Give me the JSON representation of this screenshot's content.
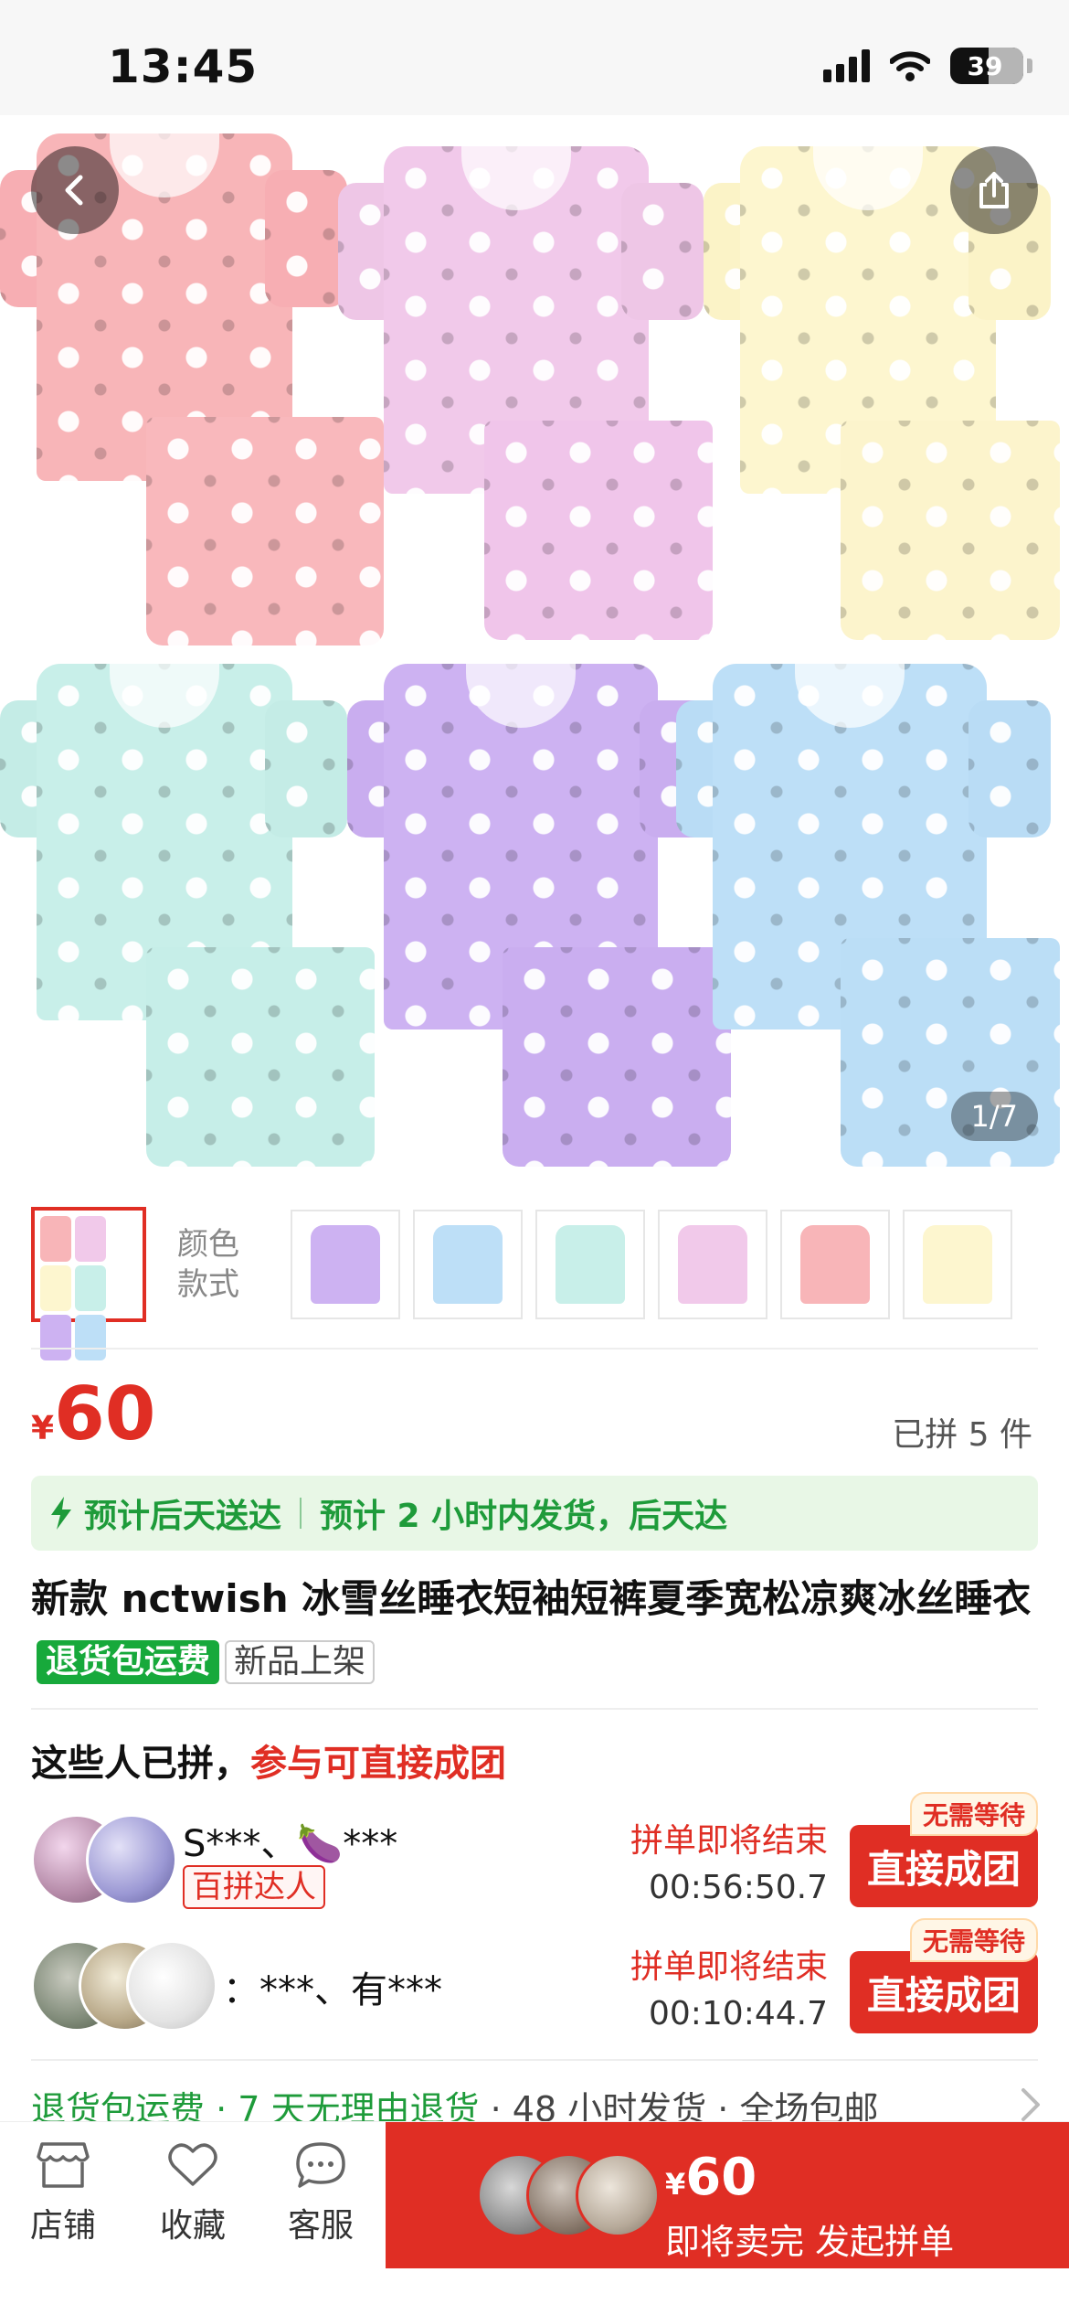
{
  "status_bar": {
    "time": "13:45",
    "battery": "39"
  },
  "gallery": {
    "counter": "1/7"
  },
  "thumbnails": {
    "label_line1": "颜色",
    "label_line2": "款式"
  },
  "price": {
    "currency": "¥",
    "amount": "60",
    "sold": "已拼 5 件"
  },
  "delivery": {
    "left": "预计后天送达",
    "right": "预计 2 小时内发货，后天达"
  },
  "title": {
    "text": "新款 nctwish 冰雪丝睡衣短袖短裤夏季宽松凉爽冰丝睡衣",
    "tag_return": "退货包运费",
    "tag_new": "新品上架"
  },
  "group": {
    "heading": "这些人已拼，",
    "heading_highlight": "参与可直接成团",
    "rows": [
      {
        "names": "S***、🍆***",
        "badge": "百拼达人",
        "ending": "拼单即将结束",
        "timer": "00:56:50.7",
        "button": "直接成团",
        "tip": "无需等待"
      },
      {
        "names": "：***、有***",
        "ending": "拼单即将结束",
        "timer": "00:10:44.7",
        "button": "直接成团",
        "tip": "无需等待"
      }
    ]
  },
  "service": {
    "item1": "退货包运费",
    "item2": "7 天无理由退货",
    "item3": "48 小时发货",
    "item4": "全场包邮"
  },
  "bottom_bar": {
    "store": "店铺",
    "favorite": "收藏",
    "service": "客服",
    "buy_currency": "¥",
    "buy_price": "60",
    "buy_label": "即将卖完 发起拼单"
  },
  "colors": {
    "accent": "#e02e24",
    "green": "#1e9b3a"
  }
}
